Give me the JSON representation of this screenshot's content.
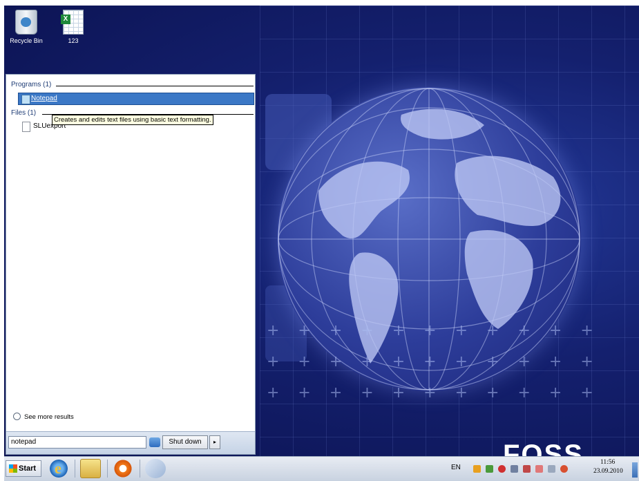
{
  "desktop": {
    "icons": [
      {
        "label": "Recycle Bin",
        "icon": "recycle-bin-icon"
      },
      {
        "label": "123",
        "icon": "excel-file-icon"
      }
    ],
    "wallpaper_brand": "FOSS"
  },
  "start_menu": {
    "programs_header": "Programs (1)",
    "program_result": {
      "label": "Notepad",
      "icon": "notepad-icon"
    },
    "files_header": "Files (1)",
    "file_result": {
      "label": "SLUexport",
      "icon": "document-icon"
    },
    "tooltip": "Creates and edits text files using basic text formatting.",
    "see_more": "See more results",
    "search_value": "notepad",
    "shutdown_label": "Shut down",
    "shutdown_arrow": "▸"
  },
  "taskbar": {
    "start_label": "Start",
    "pinned": [
      {
        "icon": "internet-explorer-icon"
      },
      {
        "icon": "windows-explorer-icon"
      },
      {
        "icon": "media-player-icon"
      },
      {
        "icon": "paint-icon"
      }
    ],
    "tray": {
      "language": "EN",
      "time": "11:56",
      "date": "23.09.2010",
      "icons": [
        "network-icon",
        "security-icon",
        "alert-icon",
        "volume-icon",
        "flag-icon",
        "app-icon",
        "clipboard-icon",
        "update-icon"
      ]
    }
  },
  "colors": {
    "wallpaper": "#14206e",
    "selection": "#3b78c6",
    "tooltip_bg": "#ffffe1"
  }
}
